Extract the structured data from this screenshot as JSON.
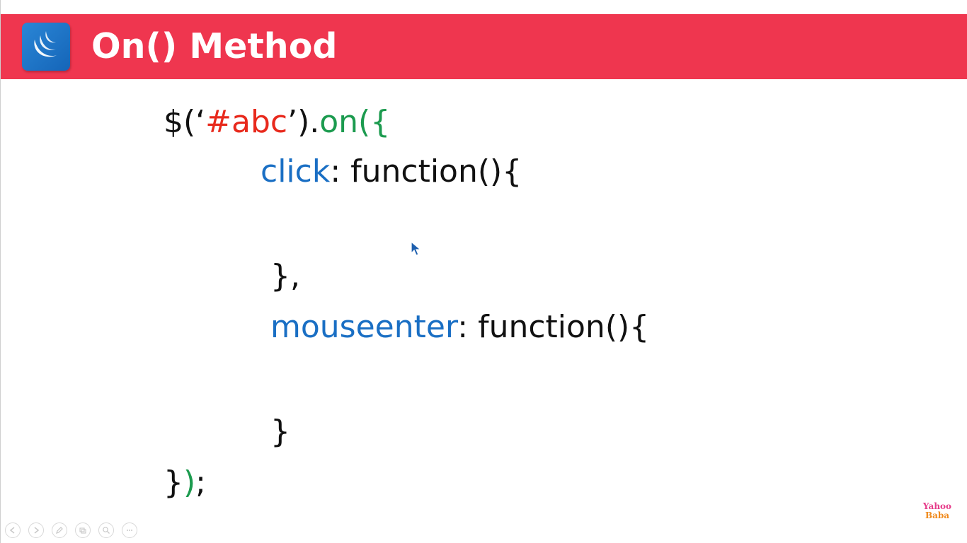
{
  "slide": {
    "title": "On() Method",
    "logo_icon": "jquery-logo-icon",
    "colors": {
      "header": "#ef364f",
      "logo_tile": "#1a72c8",
      "string": "#e8291c",
      "method": "#1c9b4f",
      "event": "#1a6fc4",
      "text": "#111111"
    }
  },
  "code": {
    "line1": {
      "prefix": "$(‘",
      "selector": "#abc",
      "suffix": "’).",
      "method": "on({"
    },
    "line2": {
      "event": "click",
      "rest": ": function(){"
    },
    "line3": {
      "text": "},"
    },
    "line4": {
      "event": "mouseenter",
      "rest": ": function(){"
    },
    "line5": {
      "text": "}"
    },
    "line6": {
      "brace": "}",
      "paren": ")",
      "end": ";"
    }
  },
  "toolbar": {
    "buttons": [
      {
        "icon": "previous-slide-icon"
      },
      {
        "icon": "next-slide-icon"
      },
      {
        "icon": "pen-icon"
      },
      {
        "icon": "slides-view-icon"
      },
      {
        "icon": "zoom-icon"
      },
      {
        "icon": "more-options-icon"
      }
    ]
  },
  "watermark": {
    "line1": "Yahoo",
    "line2": "Baba"
  }
}
